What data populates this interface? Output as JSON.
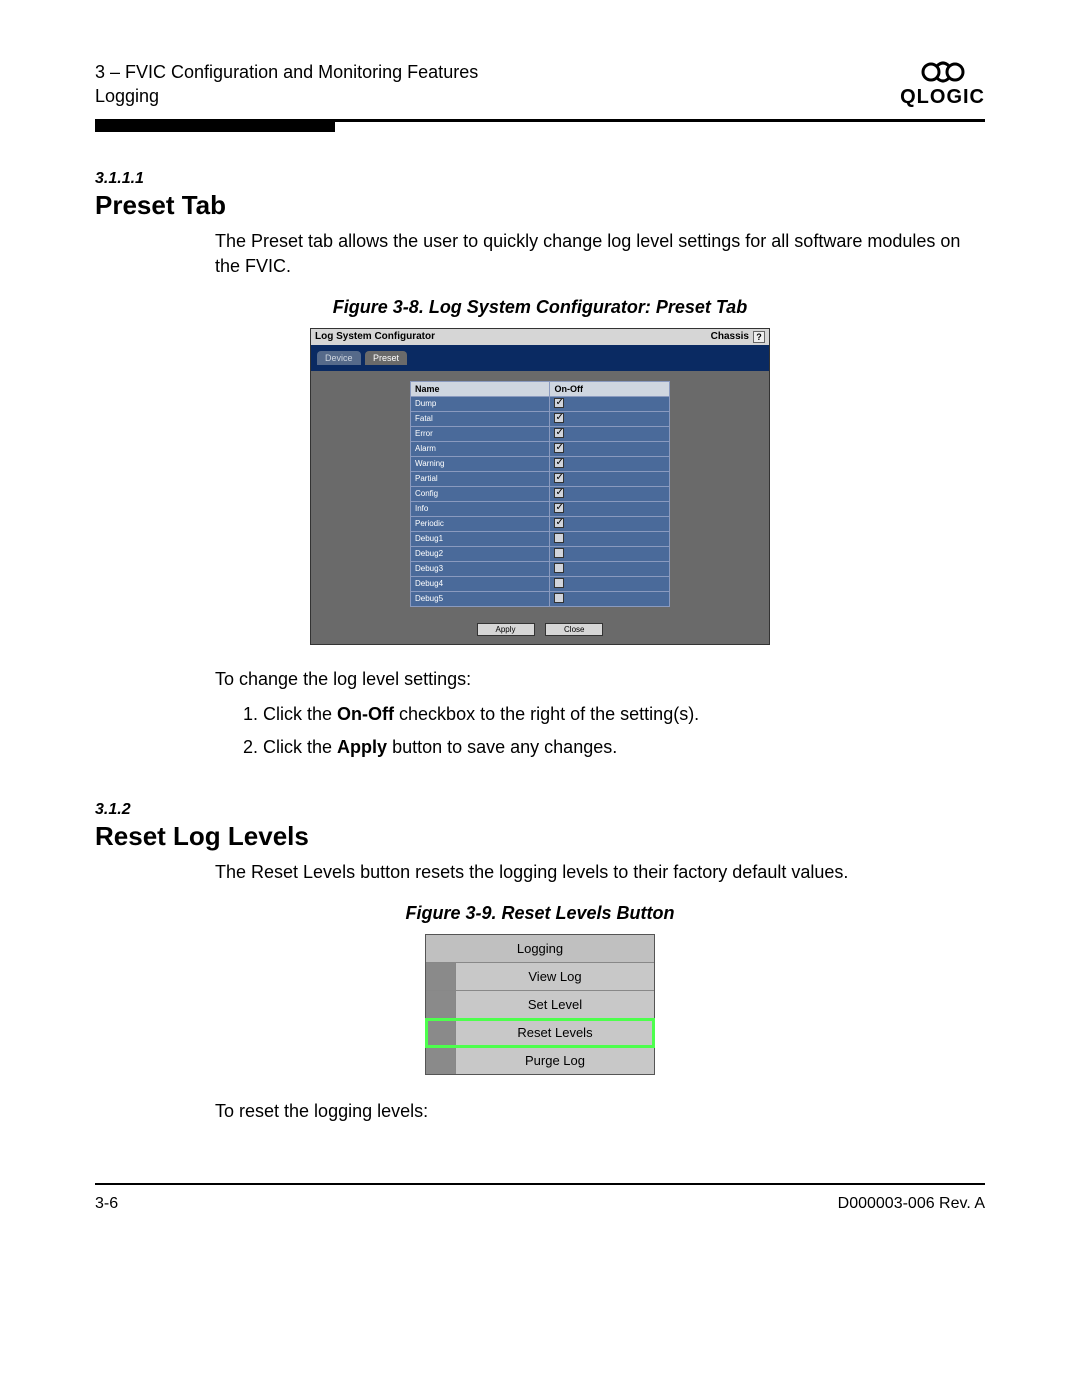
{
  "header": {
    "chapter_line": "3 – FVIC Configuration and Monitoring Features",
    "subline": "Logging",
    "brand": "QLOGIC"
  },
  "section1": {
    "number": "3.1.1.1",
    "title": "Preset Tab",
    "intro": "The Preset tab allows the user to quickly change log level settings for all software modules on the FVIC."
  },
  "figure38": {
    "caption": "Figure 3-8. Log System Configurator: Preset Tab",
    "window_title": "Log System Configurator",
    "right_label": "Chassis",
    "help_label": "?",
    "tabs": {
      "inactive": "Device",
      "active": "Preset"
    },
    "columns": {
      "name": "Name",
      "onoff": "On-Off"
    },
    "rows": [
      {
        "name": "Dump",
        "on": true
      },
      {
        "name": "Fatal",
        "on": true
      },
      {
        "name": "Error",
        "on": true
      },
      {
        "name": "Alarm",
        "on": true
      },
      {
        "name": "Warning",
        "on": true
      },
      {
        "name": "Partial",
        "on": true
      },
      {
        "name": "Config",
        "on": true
      },
      {
        "name": "Info",
        "on": true
      },
      {
        "name": "Periodic",
        "on": true
      },
      {
        "name": "Debug1",
        "on": false
      },
      {
        "name": "Debug2",
        "on": false
      },
      {
        "name": "Debug3",
        "on": false
      },
      {
        "name": "Debug4",
        "on": false
      },
      {
        "name": "Debug5",
        "on": false
      }
    ],
    "buttons": {
      "apply": "Apply",
      "close": "Close"
    }
  },
  "instructions1": {
    "lead": "To change the log level settings:",
    "step1_pre": "1.  Click the ",
    "step1_bold": "On-Off",
    "step1_post": " checkbox to the right of the setting(s).",
    "step2_pre": "2.  Click the ",
    "step2_bold": "Apply",
    "step2_post": " button to save any changes."
  },
  "section2": {
    "number": "3.1.2",
    "title": "Reset Log Levels",
    "intro": "The Reset Levels button resets the logging levels to their factory default values."
  },
  "figure39": {
    "caption": "Figure 3-9. Reset Levels Button",
    "header": "Logging",
    "items": [
      {
        "label": "View Log",
        "highlight": false
      },
      {
        "label": "Set Level",
        "highlight": false
      },
      {
        "label": "Reset Levels",
        "highlight": true
      },
      {
        "label": "Purge Log",
        "highlight": false
      }
    ]
  },
  "instructions2": {
    "lead": "To reset the logging levels:"
  },
  "footer": {
    "left": "3-6",
    "right": "D000003-006 Rev. A"
  }
}
